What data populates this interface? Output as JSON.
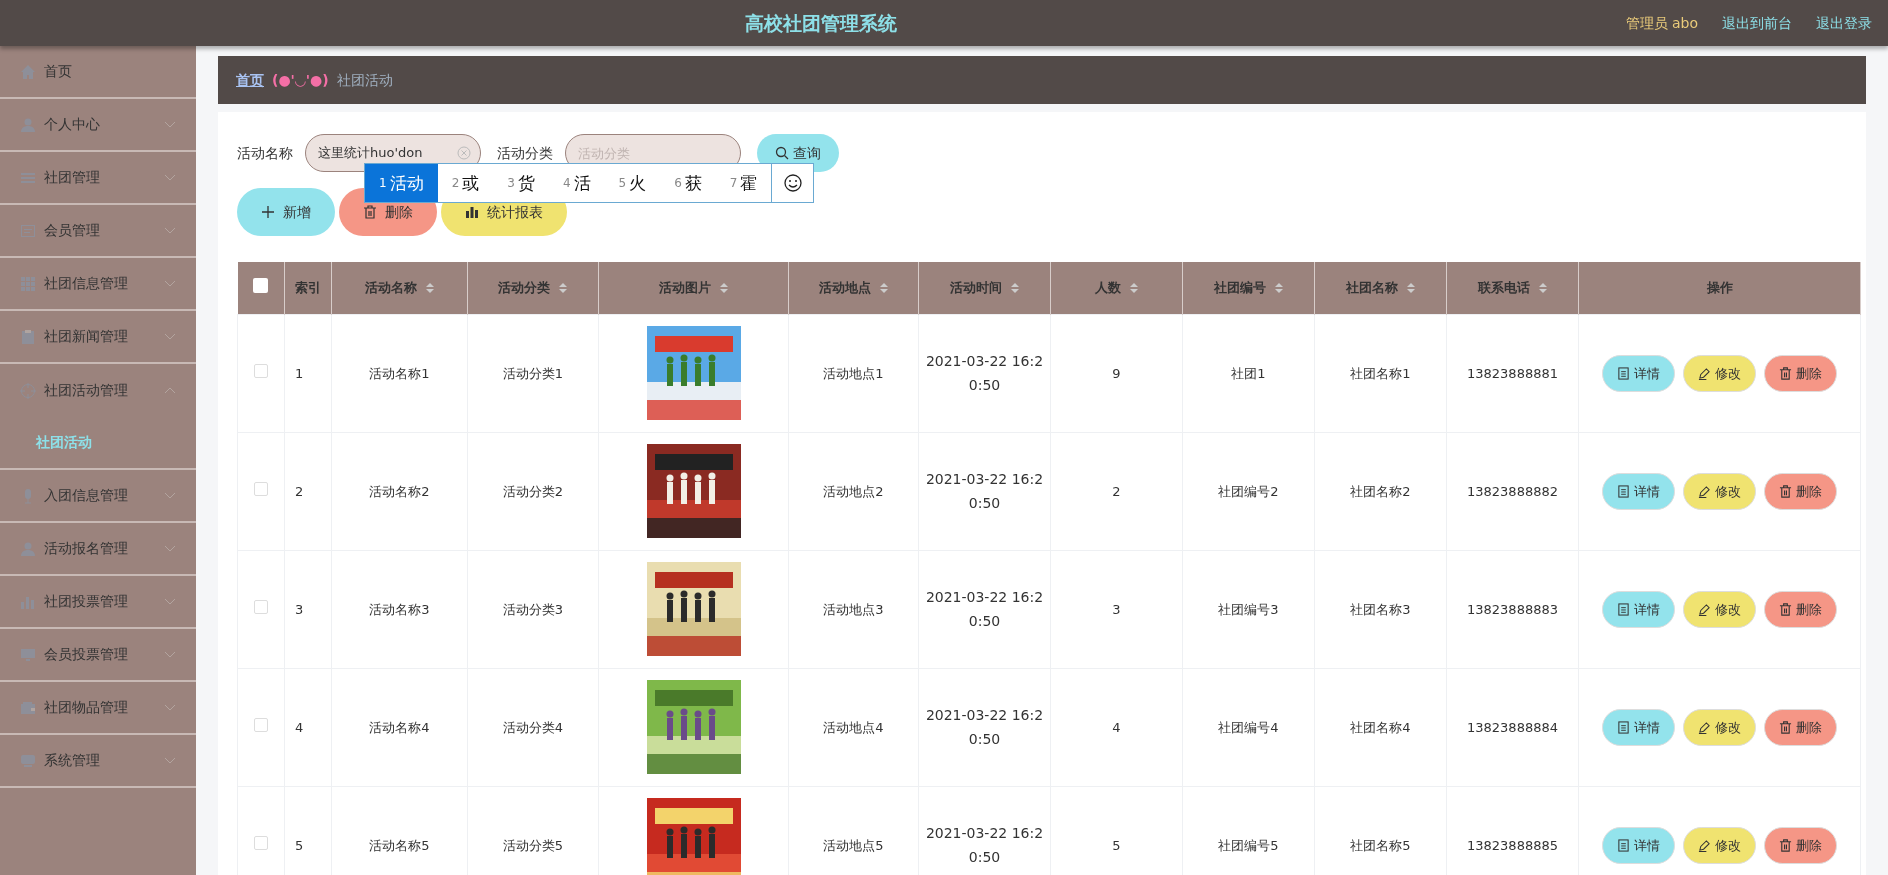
{
  "header": {
    "title": "高校社团管理系统",
    "user": "管理员 abo",
    "links": [
      "退出到前台",
      "退出登录"
    ]
  },
  "sidebar": {
    "items": [
      {
        "label": "首页",
        "expanded": false
      },
      {
        "label": "个人中心",
        "expanded": false
      },
      {
        "label": "社团管理",
        "expanded": false
      },
      {
        "label": "会员管理",
        "expanded": false
      },
      {
        "label": "社团信息管理",
        "expanded": false
      },
      {
        "label": "社团新闻管理",
        "expanded": false
      },
      {
        "label": "社团活动管理",
        "expanded": true,
        "children": [
          {
            "label": "社团活动",
            "selected": true
          }
        ]
      },
      {
        "label": "入团信息管理",
        "expanded": false
      },
      {
        "label": "活动报名管理",
        "expanded": false
      },
      {
        "label": "社团投票管理",
        "expanded": false
      },
      {
        "label": "会员投票管理",
        "expanded": false
      },
      {
        "label": "社团物品管理",
        "expanded": false
      },
      {
        "label": "系统管理",
        "expanded": false
      }
    ]
  },
  "breadcrumb": {
    "home": "首页",
    "separator": "(●'◡'●)",
    "current": "社团活动"
  },
  "search": {
    "fields": [
      {
        "label": "活动名称",
        "value": "这里统计huo'don"
      },
      {
        "label": "活动分类",
        "placeholder": "活动分类"
      }
    ],
    "button": "查询"
  },
  "ime": {
    "candidates": [
      {
        "number": "1",
        "text": "活动",
        "selected": true
      },
      {
        "number": "2",
        "text": "或",
        "selected": false
      },
      {
        "number": "3",
        "text": "货",
        "selected": false
      },
      {
        "number": "4",
        "text": "活",
        "selected": false
      },
      {
        "number": "5",
        "text": "火",
        "selected": false
      },
      {
        "number": "6",
        "text": "获",
        "selected": false
      },
      {
        "number": "7",
        "text": "霍",
        "selected": false
      }
    ]
  },
  "toolbar": [
    {
      "label": "新增",
      "kind": "add"
    },
    {
      "label": "删除",
      "kind": "delete"
    },
    {
      "label": "统计报表",
      "kind": "report"
    }
  ],
  "table": {
    "select_all": {
      "checked": false
    },
    "columns": [
      {
        "label": "索引",
        "sortable": false
      },
      {
        "label": "活动名称",
        "sortable": true
      },
      {
        "label": "活动分类",
        "sortable": true
      },
      {
        "label": "活动图片",
        "sortable": true
      },
      {
        "label": "活动地点",
        "sortable": true
      },
      {
        "label": "活动时间",
        "sortable": true
      },
      {
        "label": "人数",
        "sortable": true
      },
      {
        "label": "社团编号",
        "sortable": true
      },
      {
        "label": "社团名称",
        "sortable": true
      },
      {
        "label": "联系电话",
        "sortable": true
      },
      {
        "label": "操作",
        "sortable": false
      }
    ],
    "rows": [
      {
        "checked": false,
        "cells": [
          "1",
          "活动名称1",
          "活动分类1",
          null,
          "活动地点1",
          "2021-03-22 16:20:50",
          "9",
          "社团1",
          "社团名称1",
          "13823888881"
        ],
        "actions": [
          {
            "label": "详情",
            "kind": "detail"
          },
          {
            "label": "修改",
            "kind": "edit"
          },
          {
            "label": "删除",
            "kind": "delete"
          }
        ]
      },
      {
        "checked": false,
        "cells": [
          "2",
          "活动名称2",
          "活动分类2",
          null,
          "活动地点2",
          "2021-03-22 16:20:50",
          "2",
          "社团编号2",
          "社团名称2",
          "13823888882"
        ],
        "actions": [
          {
            "label": "详情",
            "kind": "detail"
          },
          {
            "label": "修改",
            "kind": "edit"
          },
          {
            "label": "删除",
            "kind": "delete"
          }
        ]
      },
      {
        "checked": false,
        "cells": [
          "3",
          "活动名称3",
          "活动分类3",
          null,
          "活动地点3",
          "2021-03-22 16:20:50",
          "3",
          "社团编号3",
          "社团名称3",
          "13823888883"
        ],
        "actions": [
          {
            "label": "详情",
            "kind": "detail"
          },
          {
            "label": "修改",
            "kind": "edit"
          },
          {
            "label": "删除",
            "kind": "delete"
          }
        ]
      },
      {
        "checked": false,
        "cells": [
          "4",
          "活动名称4",
          "活动分类4",
          null,
          "活动地点4",
          "2021-03-22 16:20:50",
          "4",
          "社团编号4",
          "社团名称4",
          "13823888884"
        ],
        "actions": [
          {
            "label": "详情",
            "kind": "detail"
          },
          {
            "label": "修改",
            "kind": "edit"
          },
          {
            "label": "删除",
            "kind": "delete"
          }
        ]
      },
      {
        "checked": false,
        "cells": [
          "5",
          "活动名称5",
          "活动分类5",
          null,
          "活动地点5",
          "2021-03-22 16:20:50",
          "5",
          "社团编号5",
          "社团名称5",
          "13823888885"
        ],
        "actions": [
          {
            "label": "详情",
            "kind": "detail"
          },
          {
            "label": "修改",
            "kind": "edit"
          },
          {
            "label": "删除",
            "kind": "delete"
          }
        ]
      }
    ]
  }
}
